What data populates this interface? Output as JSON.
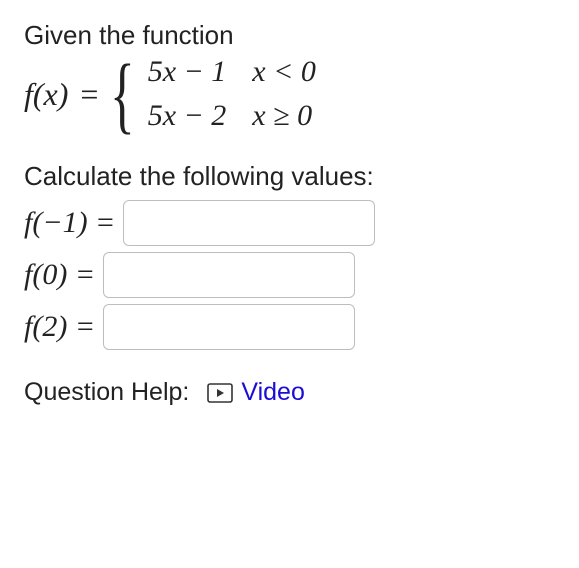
{
  "intro": "Given the function",
  "func": {
    "lhs": "f(x)",
    "eq": "=",
    "cases": [
      {
        "expr": "5x − 1",
        "cond": "x < 0"
      },
      {
        "expr": "5x − 2",
        "cond": "x ≥ 0"
      }
    ]
  },
  "calc_prompt": "Calculate the following values:",
  "calc": [
    {
      "label": "f(−1) =",
      "value": ""
    },
    {
      "label": "f(0) =",
      "value": ""
    },
    {
      "label": "f(2) =",
      "value": ""
    }
  ],
  "help": {
    "label": "Question Help:",
    "video": "Video"
  }
}
